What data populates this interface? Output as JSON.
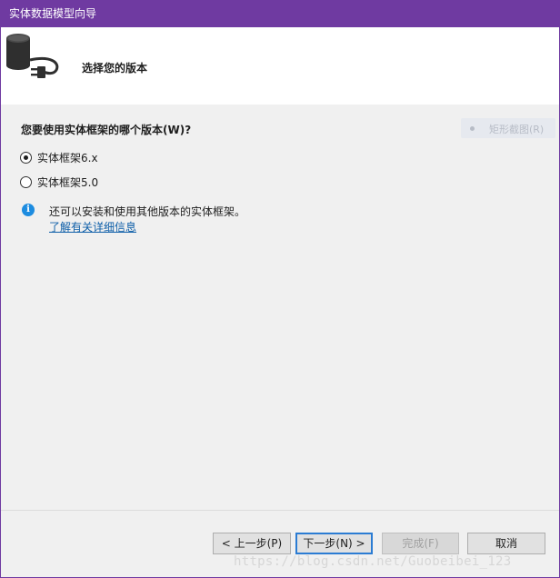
{
  "window": {
    "title": "实体数据模型向导"
  },
  "header": {
    "heading": "选择您的版本",
    "icon": "database-plug-icon"
  },
  "content": {
    "question": "您要使用实体框架的哪个版本(W)?",
    "options": [
      {
        "label": "实体框架6.x",
        "selected": true
      },
      {
        "label": "实体框架5.0",
        "selected": false
      }
    ],
    "info": {
      "icon": "info-icon",
      "text": "还可以安装和使用其他版本的实体框架。",
      "link": "了解有关详细信息"
    },
    "overlay_button": {
      "label": "矩形截图(R)"
    }
  },
  "footer": {
    "prev_label": "< 上一步(P)",
    "next_label": "下一步(N) >",
    "finish_label": "完成(F)",
    "cancel_label": "取消",
    "watermark": "https://blog.csdn.net/Guobeibei_123"
  },
  "colors": {
    "accent": "#6f3aa1",
    "link": "#0d5ea8",
    "info": "#1d8ce0"
  }
}
